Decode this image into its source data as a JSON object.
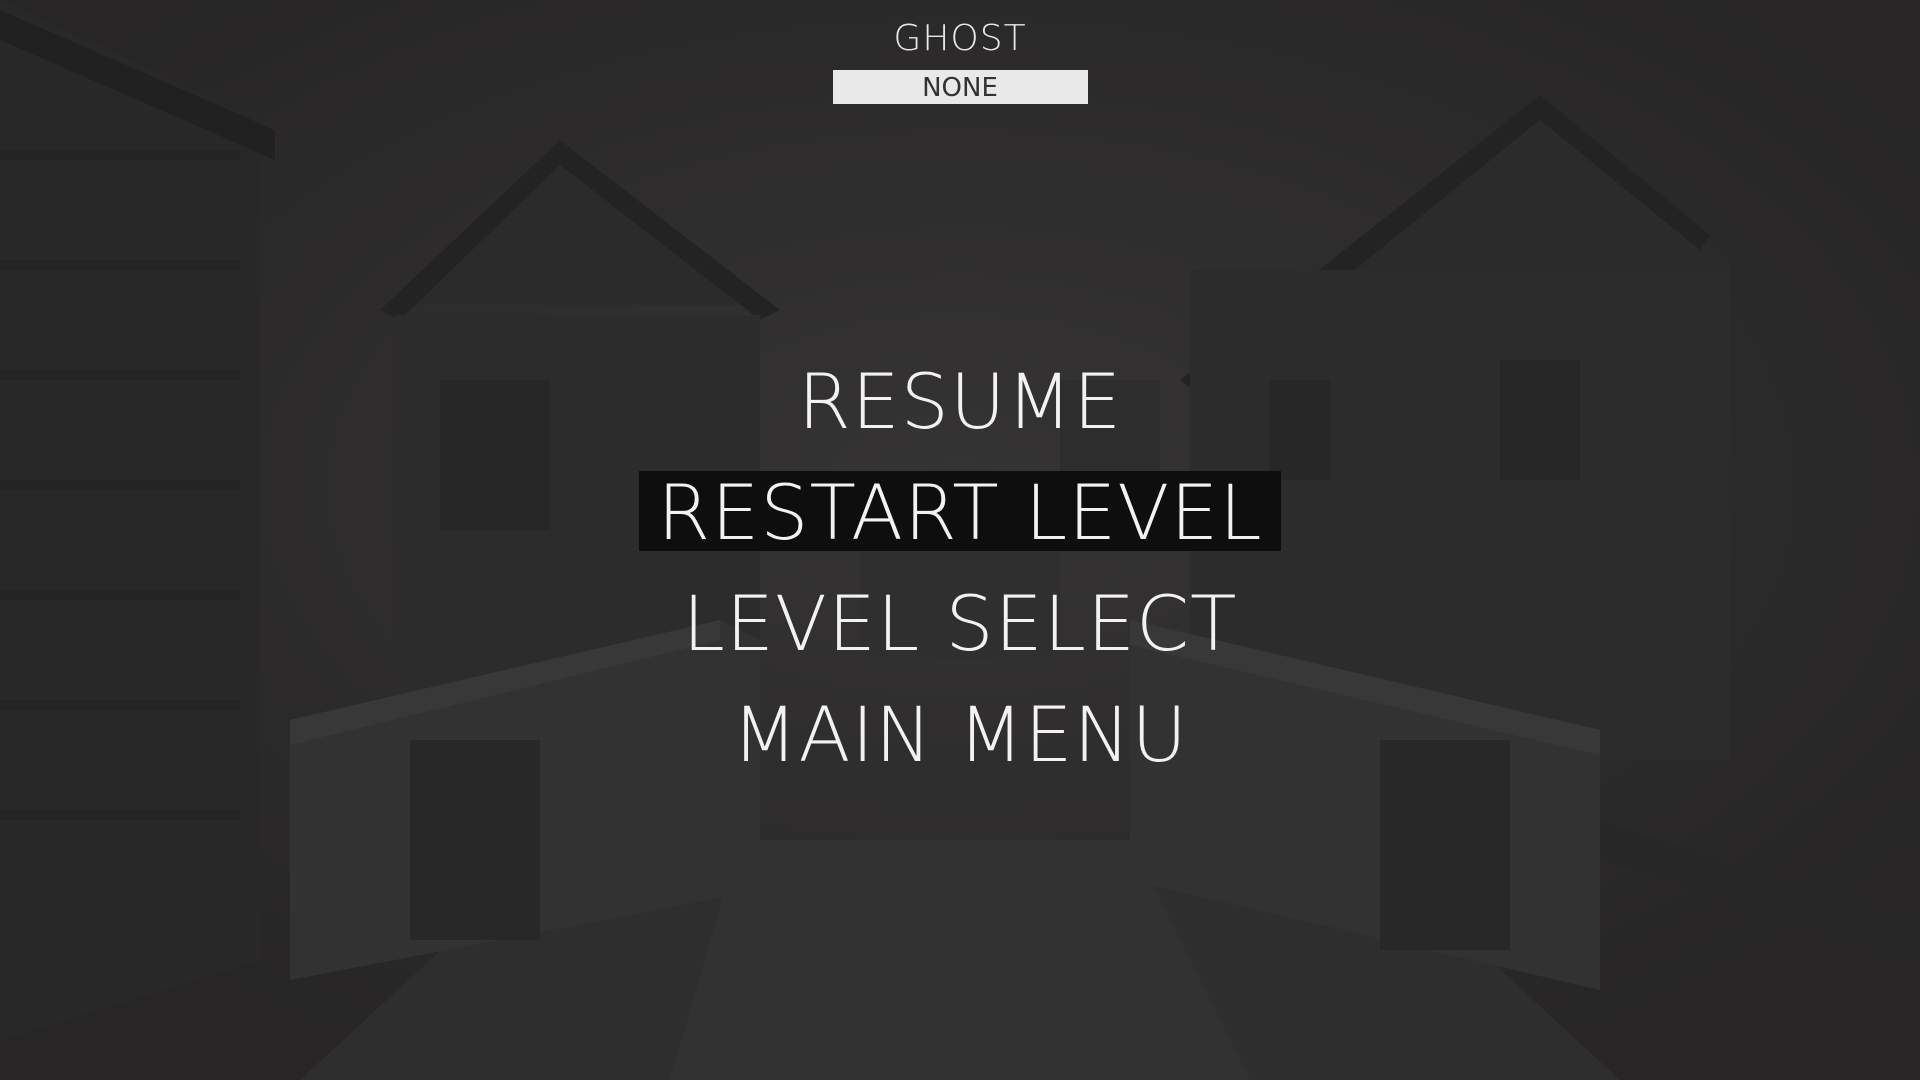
{
  "ghost": {
    "label": "GHOST",
    "value": "NONE"
  },
  "pause_menu": {
    "items": [
      {
        "label": "RESUME",
        "selected": false
      },
      {
        "label": "RESTART LEVEL",
        "selected": true
      },
      {
        "label": "LEVEL SELECT",
        "selected": false
      },
      {
        "label": "MAIN MENU",
        "selected": false
      }
    ]
  },
  "colors": {
    "menu_text": "#f2f2f2",
    "selected_highlight": "#0e0e0e",
    "dropdown_bg": "#e9e9e9",
    "dropdown_text": "#333333"
  }
}
